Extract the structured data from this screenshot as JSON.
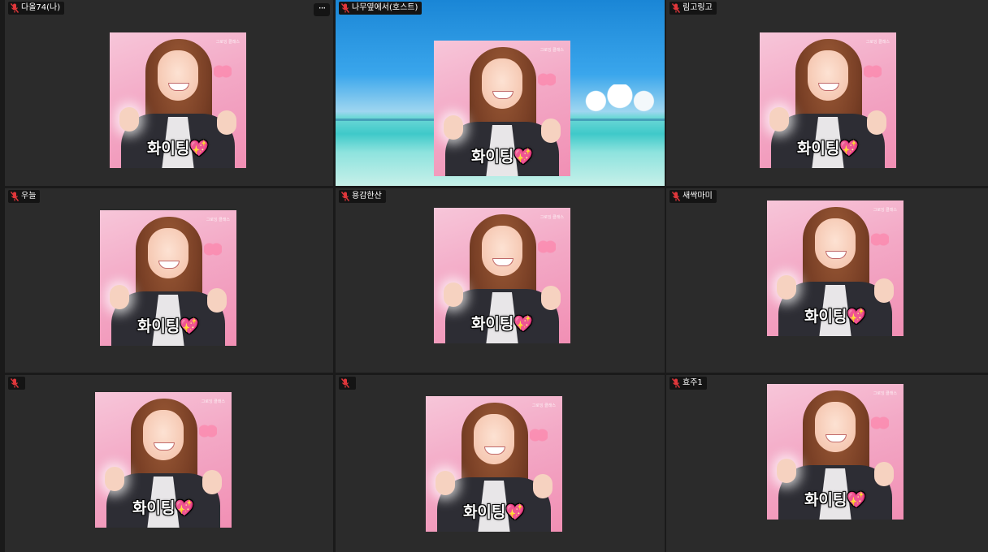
{
  "window": {
    "title": ""
  },
  "tile_menu": {
    "icon": "more-horizontal-icon",
    "label": "···"
  },
  "video_caption": "화이팅💖",
  "watermark": "그로잉 클래스",
  "colors": {
    "tile_bg": "#2b2b2b",
    "name_tag_bg": "#141414",
    "mic_muted": "#e0373b"
  },
  "participants": [
    {
      "name": "다올74(나)",
      "mic": "muted-mic-icon"
    },
    {
      "name": "나무옆에서(호스트)",
      "mic": "muted-mic-icon"
    },
    {
      "name": "림고링고",
      "mic": "muted-mic-icon"
    },
    {
      "name": "우늘",
      "mic": "muted-mic-icon"
    },
    {
      "name": "용감한산",
      "mic": "muted-mic-icon"
    },
    {
      "name": "새싹마미",
      "mic": "muted-mic-icon"
    },
    {
      "name": "",
      "mic": "muted-mic-icon"
    },
    {
      "name": "",
      "mic": "muted-mic-icon"
    },
    {
      "name": "효주1",
      "mic": "muted-mic-icon"
    }
  ]
}
